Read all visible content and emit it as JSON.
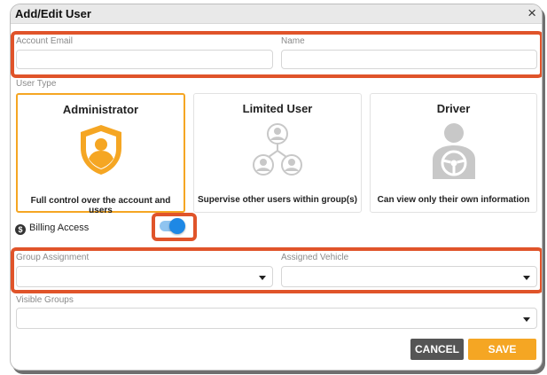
{
  "dialog": {
    "title": "Add/Edit User",
    "close_symbol": "×"
  },
  "fields": {
    "account_email": {
      "label": "Account Email",
      "value": ""
    },
    "name": {
      "label": "Name",
      "value": ""
    },
    "group_assignment": {
      "label": "Group Assignment",
      "value": ""
    },
    "assigned_vehicle": {
      "label": "Assigned Vehicle",
      "value": ""
    },
    "visible_groups": {
      "label": "Visible Groups",
      "value": ""
    }
  },
  "user_type": {
    "label": "User Type",
    "options": [
      {
        "title": "Administrator",
        "description": "Full control over the account and users",
        "icon": "admin-shield-icon",
        "selected": true
      },
      {
        "title": "Limited User",
        "description": "Supervise other users within group(s)",
        "icon": "user-hierarchy-icon",
        "selected": false
      },
      {
        "title": "Driver",
        "description": "Can view only their own information",
        "icon": "driver-steering-icon",
        "selected": false
      }
    ]
  },
  "billing": {
    "label": "Billing Access",
    "enabled": true,
    "icon": "dollar-icon"
  },
  "buttons": {
    "cancel": "CANCEL",
    "save": "SAVE"
  },
  "colors": {
    "accent": "#f5a623",
    "highlight": "#e0542a",
    "toggle": "#1e88e5",
    "cancel": "#555555"
  }
}
